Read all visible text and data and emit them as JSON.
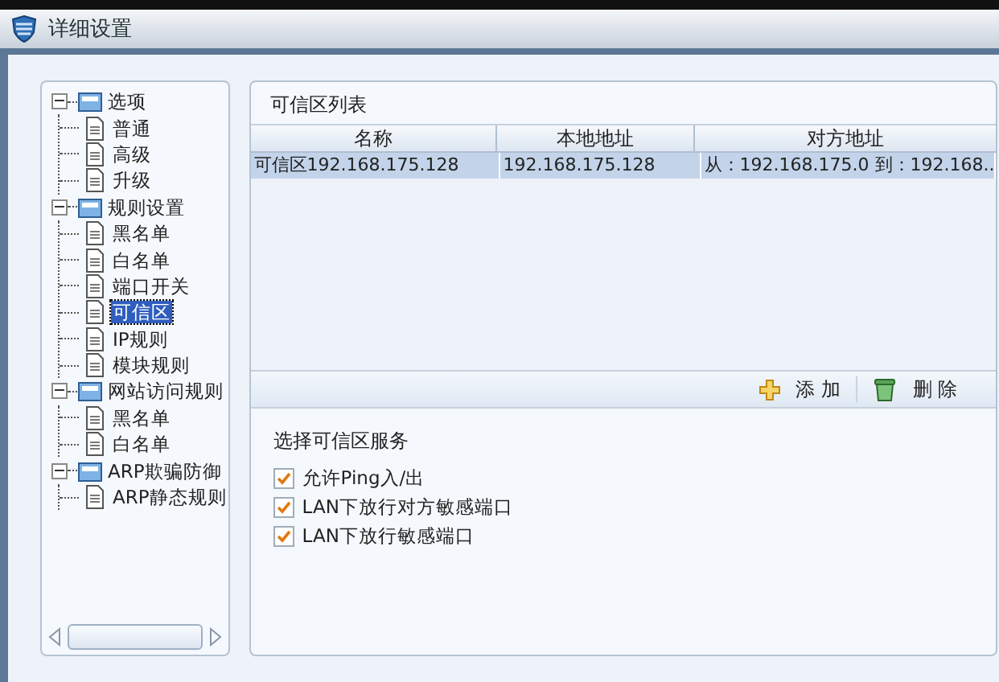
{
  "window": {
    "title": "详细设置"
  },
  "tree": [
    {
      "label": "选项",
      "expanded": true,
      "selected": false,
      "children": [
        {
          "label": "普通",
          "selected": false
        },
        {
          "label": "高级",
          "selected": false
        },
        {
          "label": "升级",
          "selected": false
        }
      ]
    },
    {
      "label": "规则设置",
      "expanded": true,
      "selected": false,
      "children": [
        {
          "label": "黑名单",
          "selected": false
        },
        {
          "label": "白名单",
          "selected": false
        },
        {
          "label": "端口开关",
          "selected": false
        },
        {
          "label": "可信区",
          "selected": true
        },
        {
          "label": "IP规则",
          "selected": false
        },
        {
          "label": "模块规则",
          "selected": false
        }
      ]
    },
    {
      "label": "网站访问规则",
      "expanded": true,
      "selected": false,
      "children": [
        {
          "label": "黑名单",
          "selected": false
        },
        {
          "label": "白名单",
          "selected": false
        }
      ]
    },
    {
      "label": "ARP欺骗防御",
      "expanded": true,
      "selected": false,
      "children": [
        {
          "label": "ARP静态规则",
          "selected": false
        }
      ]
    }
  ],
  "trusted_list": {
    "title": "可信区列表",
    "columns": [
      "名称",
      "本地地址",
      "对方地址"
    ],
    "rows": [
      {
        "cells": [
          "可信区192.168.175.128",
          "192.168.175.128",
          "从：192.168.175.0 到：192.168.."
        ],
        "selected": true
      }
    ]
  },
  "toolbar": {
    "add": "添 加",
    "delete": "删 除"
  },
  "services": {
    "title": "选择可信区服务",
    "options": [
      {
        "label": "允许Ping入/出",
        "checked": true
      },
      {
        "label": "LAN下放行对方敏感端口",
        "checked": true
      },
      {
        "label": "LAN下放行敏感端口",
        "checked": true
      }
    ]
  }
}
